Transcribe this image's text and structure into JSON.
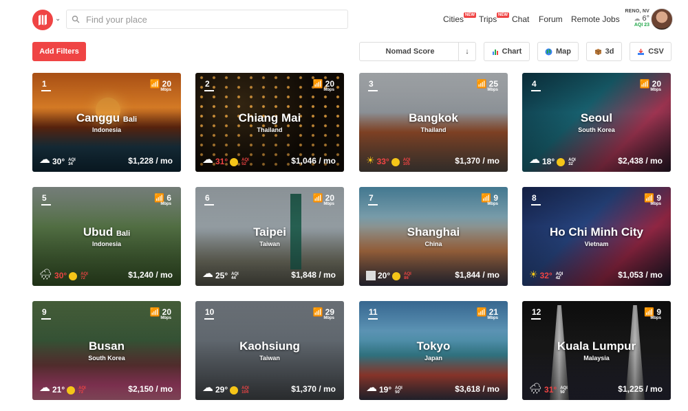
{
  "header": {
    "search_placeholder": "Find your place",
    "nav": [
      {
        "label": "Cities",
        "badge": "NEW"
      },
      {
        "label": "Trips",
        "badge": "NEW"
      },
      {
        "label": "Chat"
      },
      {
        "label": "Forum"
      },
      {
        "label": "Remote Jobs"
      }
    ],
    "weather": {
      "city": "RENO, NV",
      "temp": "6°",
      "aqi": "AQI 23"
    }
  },
  "toolbar": {
    "add_filters": "Add Filters",
    "sort": "Nomad Score",
    "sort_arrow": "↓",
    "buttons": [
      {
        "label": "Chart",
        "icon": "bar-chart-icon"
      },
      {
        "label": "Map",
        "icon": "globe-icon"
      },
      {
        "label": "3d",
        "icon": "cube-icon"
      },
      {
        "label": "CSV",
        "icon": "download-icon"
      }
    ]
  },
  "cities": [
    {
      "rank": "1",
      "name": "Canggu",
      "region": "Bali",
      "country": "Indonesia",
      "wifi": "20",
      "wifi_unit": "Mbps",
      "temp": "30°",
      "aqi": "AQI",
      "aqi_val": "34",
      "price": "$1,228 / mo",
      "weather": "cloud",
      "hot": false
    },
    {
      "rank": "2",
      "name": "Chiang Mai",
      "region": "",
      "country": "Thailand",
      "wifi": "20",
      "wifi_unit": "Mbps",
      "temp": "31°",
      "aqi": "AQI",
      "aqi_val": "52",
      "price": "$1,046 / mo",
      "weather": "cloud",
      "hot": true
    },
    {
      "rank": "3",
      "name": "Bangkok",
      "region": "",
      "country": "Thailand",
      "wifi": "25",
      "wifi_unit": "Mbps",
      "temp": "33°",
      "aqi": "AQI",
      "aqi_val": "105",
      "price": "$1,370 / mo",
      "weather": "sun",
      "hot": true
    },
    {
      "rank": "4",
      "name": "Seoul",
      "region": "",
      "country": "South Korea",
      "wifi": "20",
      "wifi_unit": "Mbps",
      "temp": "18°",
      "aqi": "AQI",
      "aqi_val": "32",
      "price": "$2,438 / mo",
      "weather": "cloud",
      "hot": false
    },
    {
      "rank": "5",
      "name": "Ubud",
      "region": "Bali",
      "country": "Indonesia",
      "wifi": "6",
      "wifi_unit": "Mbps",
      "temp": "30°",
      "aqi": "AQI",
      "aqi_val": "72",
      "price": "$1,240 / mo",
      "weather": "rain",
      "hot": true
    },
    {
      "rank": "6",
      "name": "Taipei",
      "region": "",
      "country": "Taiwan",
      "wifi": "20",
      "wifi_unit": "Mbps",
      "temp": "25°",
      "aqi": "AQI",
      "aqi_val": "44",
      "price": "$1,848 / mo",
      "weather": "cloud",
      "hot": false
    },
    {
      "rank": "7",
      "name": "Shanghai",
      "region": "",
      "country": "China",
      "wifi": "9",
      "wifi_unit": "Mbps",
      "temp": "20°",
      "aqi": "AQI",
      "aqi_val": "86",
      "price": "$1,844 / mo",
      "weather": "fog",
      "hot": false
    },
    {
      "rank": "8",
      "name": "Ho Chi Minh City",
      "region": "",
      "country": "Vietnam",
      "wifi": "9",
      "wifi_unit": "Mbps",
      "temp": "32°",
      "aqi": "AQI",
      "aqi_val": "42",
      "price": "$1,053 / mo",
      "weather": "sun",
      "hot": true
    },
    {
      "rank": "9",
      "name": "Busan",
      "region": "",
      "country": "South Korea",
      "wifi": "20",
      "wifi_unit": "Mbps",
      "temp": "21°",
      "aqi": "AQI",
      "aqi_val": "73",
      "price": "$2,150 / mo",
      "weather": "cloud",
      "hot": false
    },
    {
      "rank": "10",
      "name": "Kaohsiung",
      "region": "",
      "country": "Taiwan",
      "wifi": "29",
      "wifi_unit": "Mbps",
      "temp": "29°",
      "aqi": "AQI",
      "aqi_val": "104",
      "price": "$1,370 / mo",
      "weather": "cloud",
      "hot": false
    },
    {
      "rank": "11",
      "name": "Tokyo",
      "region": "",
      "country": "Japan",
      "wifi": "21",
      "wifi_unit": "Mbps",
      "temp": "19°",
      "aqi": "AQI",
      "aqi_val": "50",
      "price": "$3,618 / mo",
      "weather": "cloud",
      "hot": false
    },
    {
      "rank": "12",
      "name": "Kuala Lumpur",
      "region": "",
      "country": "Malaysia",
      "wifi": "9",
      "wifi_unit": "Mbps",
      "temp": "31°",
      "aqi": "AQI",
      "aqi_val": "50",
      "price": "$1,225 / mo",
      "weather": "rain",
      "hot": true
    }
  ],
  "colors": {
    "accent": "#ef4444",
    "aqi_good": "#22a84a"
  }
}
